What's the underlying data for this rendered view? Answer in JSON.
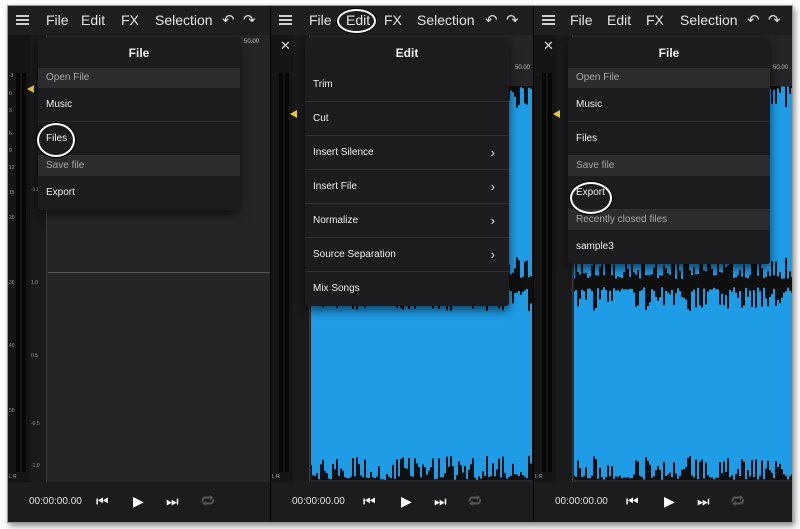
{
  "panels": [
    {
      "topbar": {
        "file": "File",
        "edit": "Edit",
        "fx": "FX",
        "selection": "Selection"
      },
      "ruler": {
        "mark": "50.00"
      },
      "meter_labels": [
        "-3",
        "0",
        "3",
        "6",
        "9",
        "12",
        "15",
        "20",
        "30",
        "40",
        "50",
        "dB"
      ],
      "scale_labels": [
        "1.0",
        "0.5",
        "-0.5",
        "-1.0",
        "1.0",
        "0.5",
        "-0.5",
        "-1.0"
      ],
      "lr": "L R",
      "menu": {
        "title": "File",
        "sections": [
          {
            "label": "Open File",
            "items": [
              "Music",
              "Files"
            ]
          },
          {
            "label": "Save file",
            "items": [
              "Export"
            ]
          }
        ]
      },
      "time": "00:00:00.00"
    },
    {
      "topbar": {
        "file": "File",
        "edit": "Edit",
        "fx": "FX",
        "selection": "Selection"
      },
      "ruler": {
        "mark": "50.00"
      },
      "lr": "L R",
      "menu": {
        "title": "Edit",
        "items": [
          {
            "label": "Trim",
            "submenu": false
          },
          {
            "label": "Cut",
            "submenu": false
          },
          {
            "label": "Insert Silence",
            "submenu": true
          },
          {
            "label": "Insert File",
            "submenu": true
          },
          {
            "label": "Normalize",
            "submenu": true
          },
          {
            "label": "Source Separation",
            "submenu": true
          },
          {
            "label": "Mix Songs",
            "submenu": false
          }
        ]
      },
      "time": "00:00:00.00"
    },
    {
      "topbar": {
        "file": "File",
        "edit": "Edit",
        "fx": "FX",
        "selection": "Selection"
      },
      "ruler": {
        "mark": "50.00"
      },
      "lr": "L R",
      "menu": {
        "title": "File",
        "sections": [
          {
            "label": "Open File",
            "items": [
              "Music",
              "Files"
            ]
          },
          {
            "label": "Save file",
            "items": [
              "Export"
            ]
          },
          {
            "label": "Recently closed files",
            "items": [
              "sample3"
            ]
          }
        ]
      },
      "time": "00:00:00.00"
    }
  ],
  "icons": {
    "menu": "hamburger-icon",
    "undo": "undo-icon",
    "redo": "redo-icon",
    "close": "close-icon",
    "rewind": "skip-back-icon",
    "play": "play-icon",
    "forward": "skip-forward-icon",
    "loop": "loop-icon",
    "chevron": "chevron-right-icon"
  },
  "colors": {
    "waveform": "#1e9ce6",
    "highlight_ring": "#ffffff",
    "background": "#1c1c1e"
  }
}
